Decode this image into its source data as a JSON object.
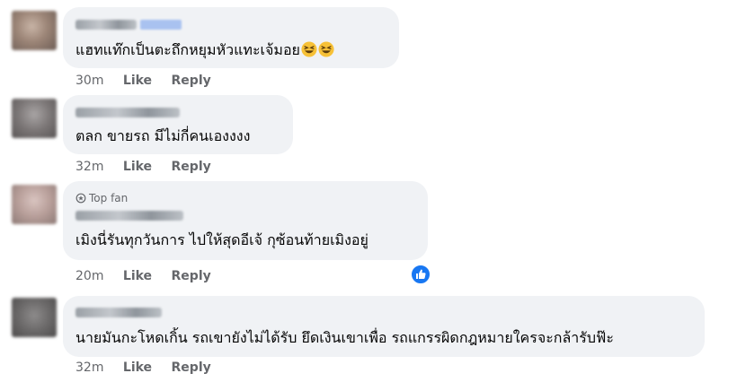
{
  "comments": [
    {
      "text": "แฮทแท๊กเป็นตะถึกหยุมหัวแทะเจ้มอย",
      "emojis": [
        "grinning-squinting-face",
        "grinning-squinting-face"
      ],
      "time": "30m",
      "like": "Like",
      "reply": "Reply"
    },
    {
      "text": "ตลก ขายรถ มีไม่กี่คนเองงงง",
      "time": "32m",
      "like": "Like",
      "reply": "Reply"
    },
    {
      "badge": "Top fan",
      "text": "เมิงนี่รันทุกวันการ ไปให้สุดอีเจ้ กุซ้อนท้ายเมิงอยู่",
      "time": "20m",
      "like": "Like",
      "reply": "Reply",
      "reaction": "like-reaction",
      "reaction_color": "#1877f2"
    },
    {
      "text": "นายมันกะโหดเกิ้น รถเขายังไม่ได้รับ ยึดเงินเขาเพื่อ รถแกรรผิดกฎหมายใครจะกล้ารับฟ๊ะ",
      "time": "32m",
      "like": "Like",
      "reply": "Reply"
    }
  ],
  "colors": {
    "bubble": "#f0f2f5",
    "meta_text": "#65676b",
    "body_text": "#050505",
    "like_blue": "#1877f2"
  }
}
